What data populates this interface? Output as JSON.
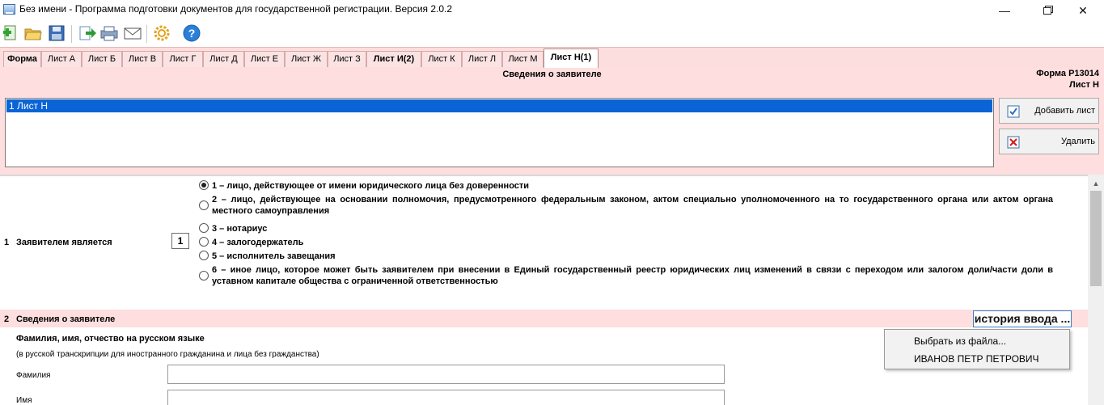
{
  "window": {
    "title": "Без имени - Программа подготовки документов для государственной регистрации. Версия 2.0.2",
    "minimize": "—",
    "close": "✕"
  },
  "toolbar": {
    "icons": [
      "new-document-icon",
      "open-folder-icon",
      "save-icon",
      "export-icon",
      "print-icon",
      "mail-icon",
      "settings-icon",
      "help-icon"
    ]
  },
  "tabs": [
    {
      "label": "Форма",
      "bold": true
    },
    {
      "label": "Лист А"
    },
    {
      "label": "Лист Б"
    },
    {
      "label": "Лист В"
    },
    {
      "label": "Лист Г"
    },
    {
      "label": "Лист Д"
    },
    {
      "label": "Лист Е"
    },
    {
      "label": "Лист Ж"
    },
    {
      "label": "Лист З"
    },
    {
      "label": "Лист И(2)",
      "bold": true
    },
    {
      "label": "Лист К"
    },
    {
      "label": "Лист Л"
    },
    {
      "label": "Лист М"
    },
    {
      "label": "Лист Н(1)",
      "active": true
    }
  ],
  "header": {
    "heading": "Сведения о заявителе",
    "form_code": "Форма Р13014",
    "sheet_code": "Лист Н"
  },
  "sheet_list": {
    "items": [
      "1 Лист Н"
    ],
    "add_button": "Добавить лист",
    "delete_button": "Удалить"
  },
  "section1": {
    "number": "1",
    "label": "Заявителем является",
    "code_value": "1",
    "options": [
      {
        "text": "1 – лицо, действующее от имени юридического лица без доверенности",
        "selected": true
      },
      {
        "text": "2 – лицо, действующее на основании полномочия, предусмотренного федеральным законом, актом специально уполномоченного на то государственного органа или актом органа местного самоуправления",
        "selected": false
      },
      {
        "text": "3 – нотариус",
        "selected": false
      },
      {
        "text": "4 – залогодержатель",
        "selected": false
      },
      {
        "text": "5 – исполнитель завещания",
        "selected": false
      },
      {
        "text": "6 – иное лицо, которое может быть заявителем при внесении в Единый государственный реестр юридических лиц изменений в связи с переходом или залогом доли/части доли в уставном капитале общества с ограниченной ответственностью",
        "selected": false
      }
    ]
  },
  "section2": {
    "number": "2",
    "label": "Сведения о заявителе",
    "history_button": "история ввода ...",
    "fio_title": "Фамилия, имя, отчество на русском языке",
    "fio_hint": "(в русской транскрипции для иностранного гражданина и лица без гражданства)",
    "surname_label": "Фамилия",
    "surname_value": "",
    "name_label": "Имя",
    "name_value": ""
  },
  "history_menu": {
    "items": [
      "Выбрать из файла...",
      "ИВАНОВ ПЕТР ПЕТРОВИЧ"
    ]
  },
  "colors": {
    "pink_panel": "#fedede",
    "selection": "#0a64d6"
  }
}
